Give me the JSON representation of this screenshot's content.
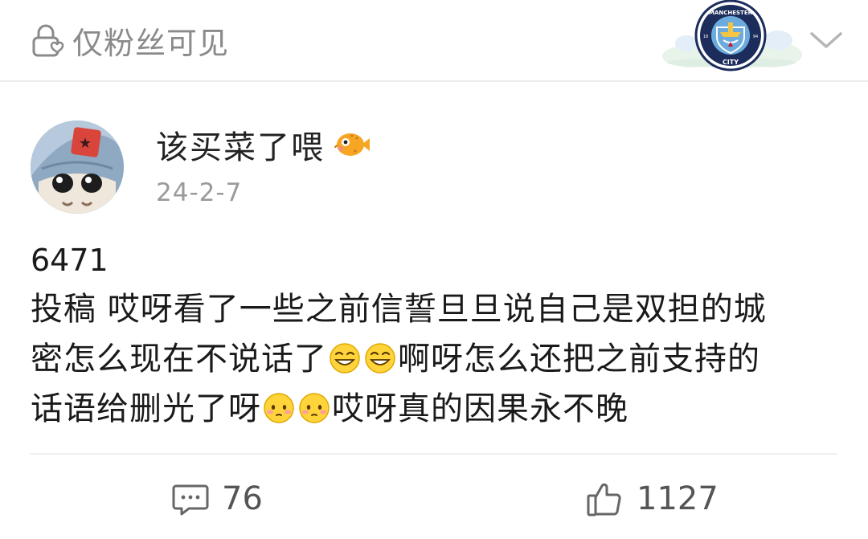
{
  "header": {
    "visibility_label": "仅粉丝可见",
    "badge_text_top": "MANCHESTER",
    "badge_text_bottom": "CITY",
    "badge_year_left": "18",
    "badge_year_right": "94"
  },
  "post": {
    "username": "该买菜了喂",
    "date": "24-2-7",
    "number": "6471",
    "lines": [
      {
        "text_a": "投稿 哎呀看了一些之前信誓旦旦说自己是双担的城"
      },
      {
        "text_a": "密怎么现在不说话了",
        "text_b": "啊呀怎么还把之前支持的"
      },
      {
        "text_a": "话语给删光了呀",
        "text_b": "哎呀真的因果永不晚"
      }
    ]
  },
  "footer": {
    "comment_count": "76",
    "like_count": "1127"
  },
  "colors": {
    "accent_badge": "#1c2c5b",
    "sky_blue": "#6cabdd",
    "muted_text": "#8a8a8a"
  }
}
